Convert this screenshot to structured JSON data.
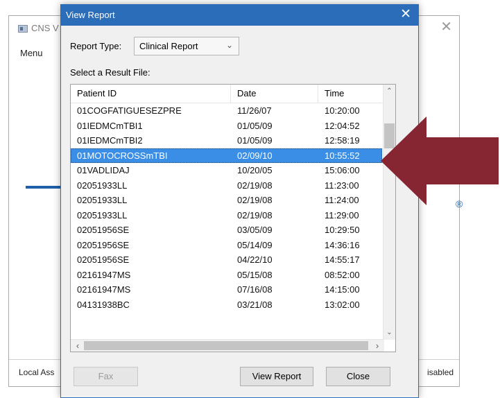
{
  "background_window": {
    "title": "CNS V",
    "menu_label": "Menu",
    "status_left": "Local Ass",
    "status_right": "isabled",
    "registered_mark": "®"
  },
  "dialog": {
    "title": "View Report",
    "close_glyph": "✕",
    "report_type_label": "Report Type:",
    "report_type_value": "Clinical Report",
    "select_file_label": "Select a Result File:",
    "columns": [
      "Patient ID",
      "Date",
      "Time"
    ],
    "rows": [
      {
        "patient_id": "01COGFATIGUESEZPRE",
        "date": "11/26/07",
        "time": "10:20:00"
      },
      {
        "patient_id": "01IEDMCmTBI1",
        "date": "01/05/09",
        "time": "12:04:52"
      },
      {
        "patient_id": "01IEDMCmTBI2",
        "date": "01/05/09",
        "time": "12:58:19"
      },
      {
        "patient_id": "01MOTOCROSSmTBI",
        "date": "02/09/10",
        "time": "10:55:52",
        "selected": true
      },
      {
        "patient_id": "01VADLIDAJ",
        "date": "10/20/05",
        "time": "15:06:00"
      },
      {
        "patient_id": "02051933LL",
        "date": "02/19/08",
        "time": "11:23:00"
      },
      {
        "patient_id": "02051933LL",
        "date": "02/19/08",
        "time": "11:24:00"
      },
      {
        "patient_id": "02051933LL",
        "date": "02/19/08",
        "time": "11:29:00"
      },
      {
        "patient_id": "02051956SE",
        "date": "03/05/09",
        "time": "10:29:50"
      },
      {
        "patient_id": "02051956SE",
        "date": "05/14/09",
        "time": "14:36:16"
      },
      {
        "patient_id": "02051956SE",
        "date": "04/22/10",
        "time": "14:55:17"
      },
      {
        "patient_id": "02161947MS",
        "date": "05/15/08",
        "time": "08:52:00"
      },
      {
        "patient_id": "02161947MS",
        "date": "07/16/08",
        "time": "14:15:00"
      },
      {
        "patient_id": "04131938BC",
        "date": "03/21/08",
        "time": "13:02:00"
      }
    ],
    "buttons": {
      "fax": "Fax",
      "view_report": "View Report",
      "close": "Close"
    }
  },
  "colors": {
    "title_bar": "#2b6db8",
    "selection": "#3a8ee6",
    "arrow": "#862633"
  },
  "icons": [
    "close-icon",
    "chevron-down-icon",
    "scroll-up-icon",
    "scroll-down-icon",
    "scroll-left-icon",
    "scroll-right-icon",
    "pointer-arrow-icon"
  ]
}
